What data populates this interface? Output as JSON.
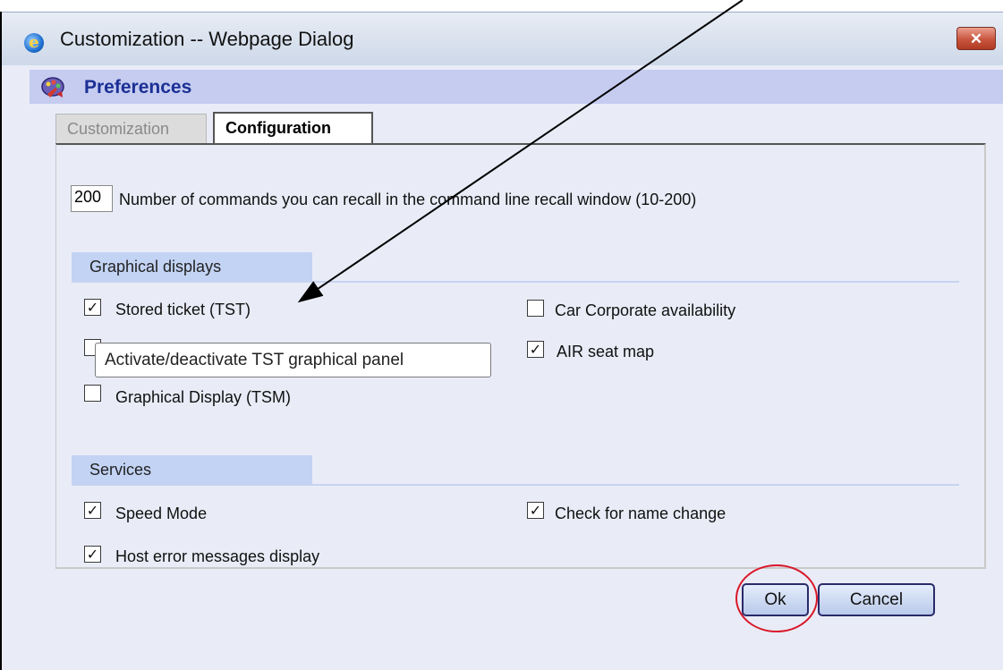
{
  "window": {
    "title": "Customization -- Webpage Dialog",
    "close_label": "✕"
  },
  "header": {
    "title": "Preferences"
  },
  "tabs": [
    {
      "label": "Customization",
      "active": false
    },
    {
      "label": "Configuration",
      "active": true
    }
  ],
  "recall": {
    "value": "200",
    "label": "Number of commands you can recall in the command line recall window (10-200)"
  },
  "graphical_displays": {
    "title": "Graphical displays",
    "items": [
      {
        "label": "Stored ticket (TST)",
        "checked": true
      },
      {
        "label": "Car Corporate availability",
        "checked": false
      },
      {
        "label": "",
        "checked": false
      },
      {
        "label": "AIR seat map",
        "checked": true
      },
      {
        "label": "Graphical Display (TSM)",
        "checked": false
      }
    ]
  },
  "tooltip": "Activate/deactivate TST graphical panel",
  "services": {
    "title": "Services",
    "items": [
      {
        "label": "Speed Mode",
        "checked": true
      },
      {
        "label": "Check for name change",
        "checked": true
      },
      {
        "label": "Host error messages display",
        "checked": true
      }
    ]
  },
  "buttons": {
    "ok": "Ok",
    "cancel": "Cancel"
  },
  "colors": {
    "client_bg": "#e9ecf7",
    "section_bg": "#c2d3f4",
    "title_color": "#1b2f95",
    "annotation_circle": "#d9182a"
  },
  "icons": {
    "window_icon": "internet-explorer-icon",
    "preferences_icon": "palette-preferences-icon"
  }
}
